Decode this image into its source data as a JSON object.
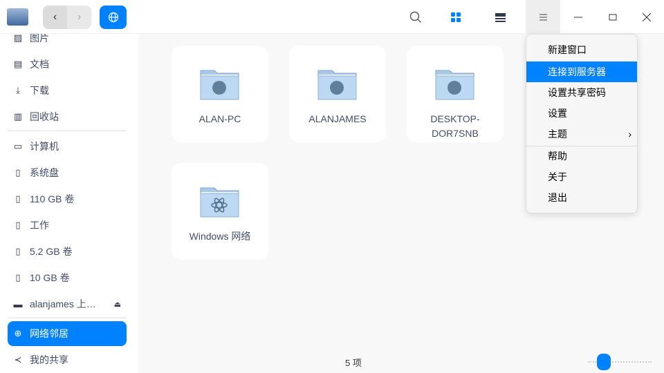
{
  "header": {
    "back": "‹",
    "forward": "›"
  },
  "sidebar": {
    "items": [
      {
        "label": "图片",
        "icon": "pictures-icon"
      },
      {
        "label": "文档",
        "icon": "documents-icon"
      },
      {
        "label": "下载",
        "icon": "downloads-icon"
      },
      {
        "label": "回收站",
        "icon": "trash-icon"
      },
      {
        "label": "计算机",
        "icon": "computer-icon"
      },
      {
        "label": "系统盘",
        "icon": "disk-icon"
      },
      {
        "label": "110 GB 卷",
        "icon": "disk-icon"
      },
      {
        "label": "工作",
        "icon": "disk-icon"
      },
      {
        "label": "5.2 GB 卷",
        "icon": "disk-icon"
      },
      {
        "label": "10 GB 卷",
        "icon": "disk-icon"
      },
      {
        "label": "alanjames 上…",
        "icon": "network-share-icon"
      },
      {
        "label": "网络邻居",
        "icon": "globe-icon"
      },
      {
        "label": "我的共享",
        "icon": "share-icon"
      }
    ]
  },
  "main": {
    "items": [
      {
        "label": "ALAN-PC"
      },
      {
        "label": "ALANJAMES"
      },
      {
        "label": "DESKTOP-DOR7SNB"
      },
      {
        "label": "Windows 网络"
      }
    ]
  },
  "menu": {
    "items": [
      "新建窗口",
      "连接到服务器",
      "设置共享密码",
      "设置",
      "主题",
      "帮助",
      "关于",
      "退出"
    ],
    "highlighted": "连接到服务器"
  },
  "status": {
    "count": "5 项"
  },
  "zoom_slider": {
    "value": 0.25
  },
  "colors": {
    "accent": "#0081ff"
  }
}
